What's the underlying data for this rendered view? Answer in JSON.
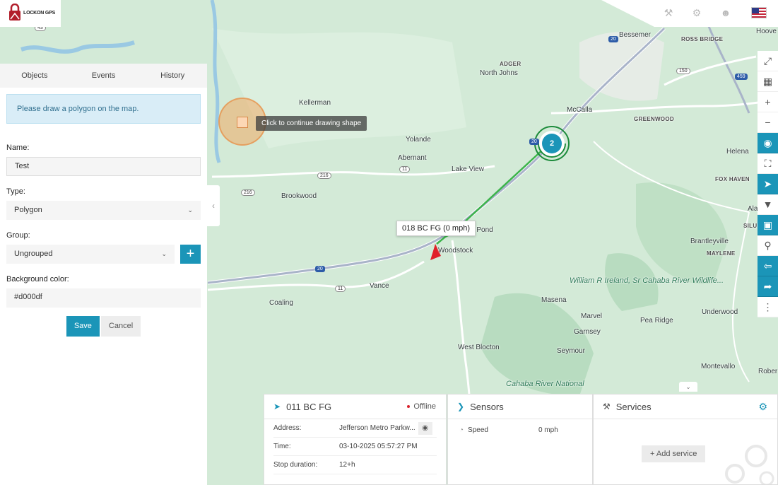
{
  "brand": {
    "name": "LOCKON GPS"
  },
  "panel": {
    "tabs": [
      "Objects",
      "Events",
      "History"
    ],
    "notice": "Please draw a polygon on the map.",
    "name_label": "Name:",
    "name_value": "Test",
    "type_label": "Type:",
    "type_value": "Polygon",
    "group_label": "Group:",
    "group_value": "Ungrouped",
    "bg_label": "Background color:",
    "bg_value": "#d000df",
    "save_label": "Save",
    "cancel_label": "Cancel"
  },
  "map": {
    "draw_tip": "Click to continue drawing shape",
    "cluster_count": "2",
    "vehicle_label": "018 BC FG (0 mph)",
    "places": {
      "bessemer": "Bessemer",
      "ross_bridge": "ROSS BRIDGE",
      "hoover": "Hoove",
      "adger": "ADGER",
      "north_johns": "North Johns",
      "kellerman": "Kellerman",
      "mccalla": "McCalla",
      "greenwood": "GREENWOOD",
      "yolande": "Yolande",
      "abernant": "Abernant",
      "helena": "Helena",
      "lake_view": "Lake View",
      "brookwood": "Brookwood",
      "fox_haven": "FOX HAVEN",
      "ala": "Ala",
      "silu": "SILU",
      "pond": "n Pond",
      "woodstock": "Woodstock",
      "brantleyville": "Brantleyville",
      "maylene": "MAYLENE",
      "vance": "Vance",
      "coaling": "Coaling",
      "masena": "Masena",
      "marvel": "Marvel",
      "pea_ridge": "Pea Ridge",
      "underwood": "Underwood",
      "garnsey": "Garnsey",
      "seymour": "Seymour",
      "west_blocton": "West Blocton",
      "montevallo": "Montevallo",
      "rober": "Rober",
      "cahaba": "Cahaba River National",
      "wildlife": "William R Ireland, Sr Cahaba River Wildlife..."
    },
    "highways": [
      "43",
      "20",
      "150",
      "459",
      "216",
      "216",
      "11",
      "20",
      "11",
      "20"
    ]
  },
  "object_panel": {
    "title": "011 BC FG",
    "status": "Offline",
    "rows": [
      {
        "k": "Address:",
        "v": "Jefferson Metro Parkw..."
      },
      {
        "k": "Time:",
        "v": "03-10-2025 05:57:27 PM"
      },
      {
        "k": "Stop duration:",
        "v": "12+h"
      }
    ]
  },
  "sensors_panel": {
    "title": "Sensors",
    "sensor_name": "Speed",
    "sensor_value": "0 mph"
  },
  "services_panel": {
    "title": "Services",
    "add_label": "Add service"
  },
  "colors": {
    "accent": "#1b95b8",
    "route": "#3bb44a",
    "vehicle": "#e0202a"
  }
}
